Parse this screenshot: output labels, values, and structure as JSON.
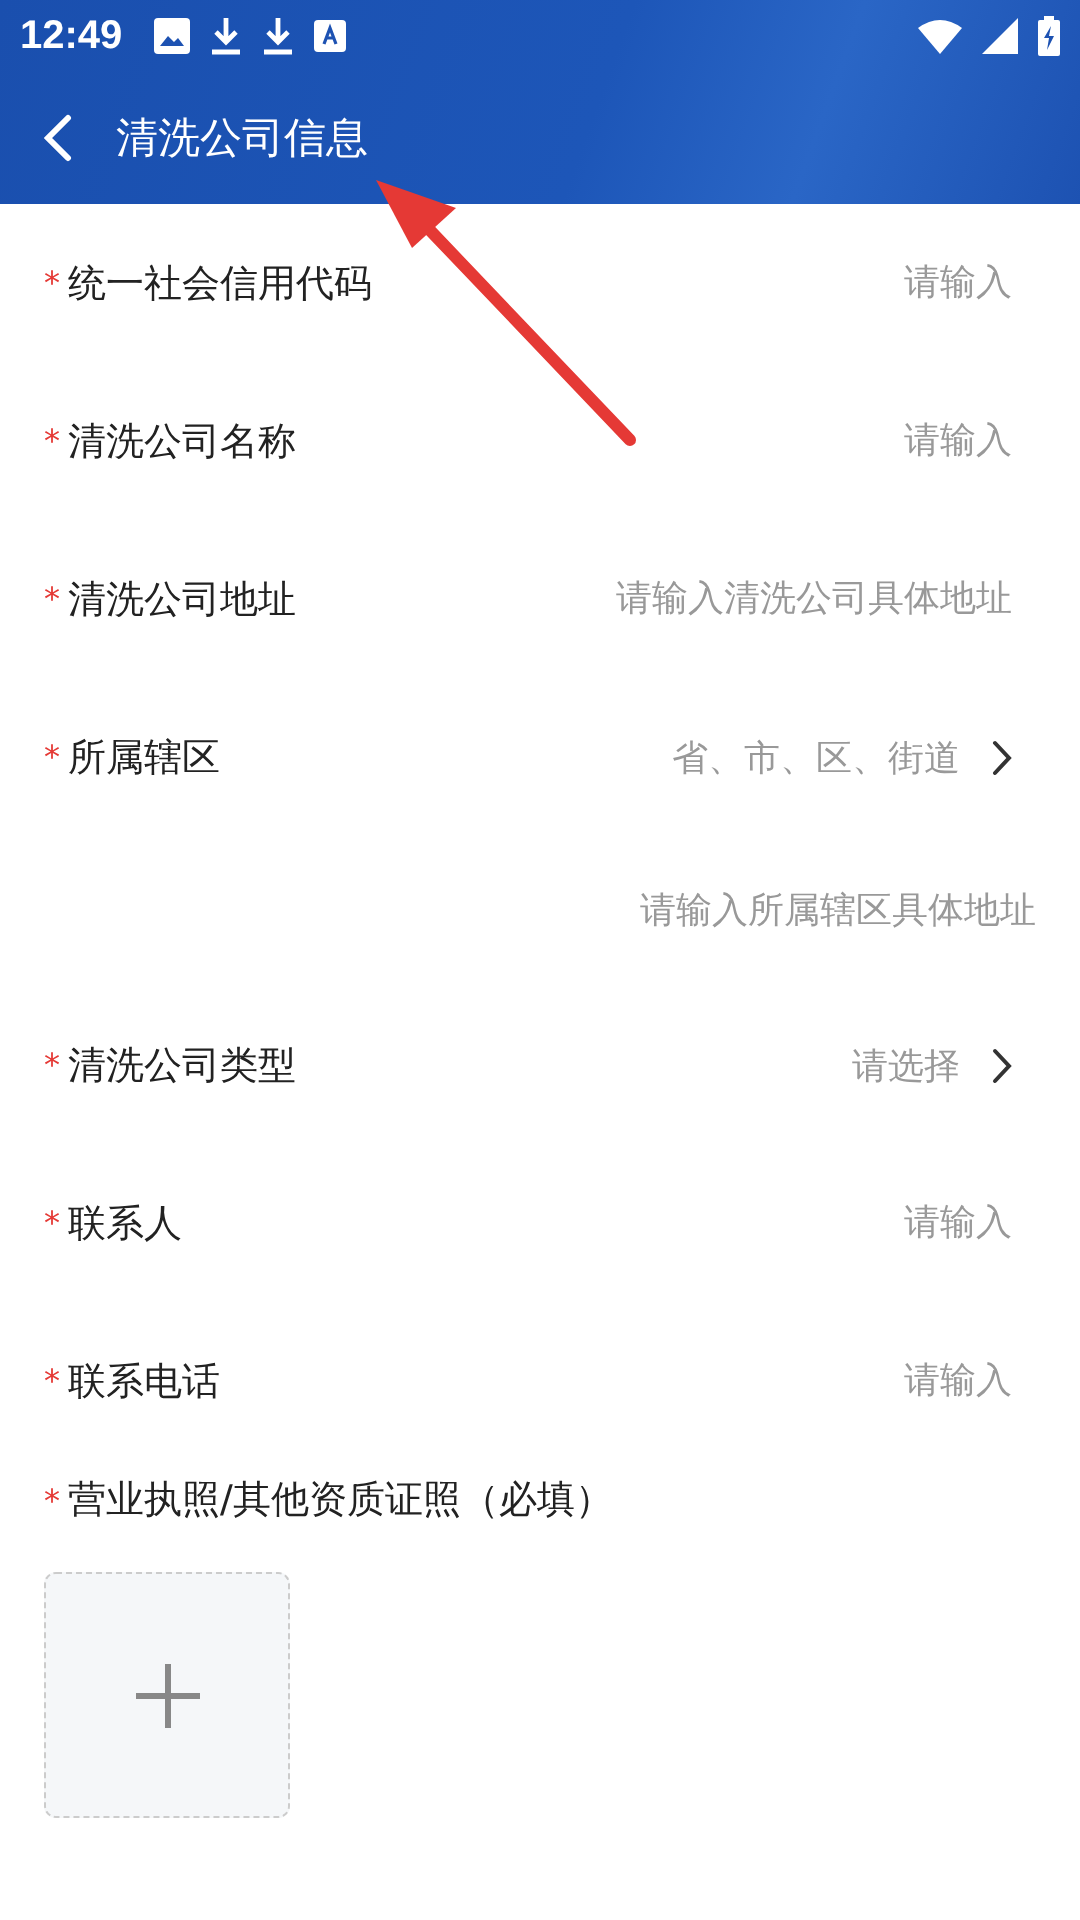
{
  "status_bar": {
    "time": "12:49"
  },
  "header": {
    "title": "清洗公司信息"
  },
  "fields": [
    {
      "kind": "input",
      "required_mark": "*",
      "label": "统一社会信用代码",
      "placeholder": "请输入"
    },
    {
      "kind": "input",
      "required_mark": "*",
      "label": "清洗公司名称",
      "placeholder": "请输入"
    },
    {
      "kind": "input",
      "required_mark": "*",
      "label": "清洗公司地址",
      "placeholder": "请输入清洗公司具体地址"
    },
    {
      "kind": "select",
      "required_mark": "*",
      "label": "所属辖区",
      "placeholder": "省、市、区、街道"
    },
    {
      "kind": "detail",
      "placeholder": "请输入所属辖区具体地址"
    },
    {
      "kind": "select",
      "required_mark": "*",
      "label": "清洗公司类型",
      "placeholder": "请选择"
    },
    {
      "kind": "input",
      "required_mark": "*",
      "label": "联系人",
      "placeholder": "请输入"
    },
    {
      "kind": "input",
      "required_mark": "*",
      "label": "联系电话",
      "placeholder": "请输入"
    }
  ],
  "upload": {
    "required_mark": "*",
    "label": "营业执照/其他资质证照（必填）"
  }
}
